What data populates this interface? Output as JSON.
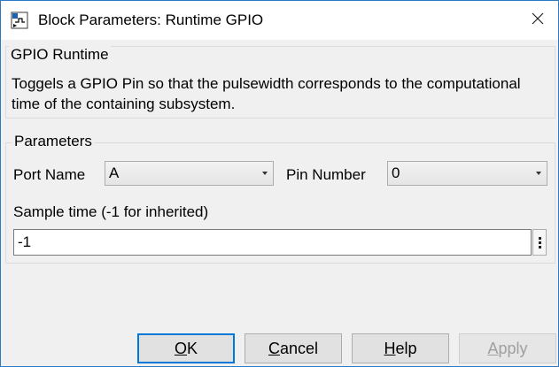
{
  "window": {
    "title": "Block Parameters: Runtime GPIO"
  },
  "description": {
    "heading": "GPIO Runtime",
    "text": "Toggels a GPIO Pin so that the pulsewidth corresponds to the computational time of the containing subsystem."
  },
  "parameters": {
    "heading": "Parameters",
    "port_name": {
      "label": "Port Name",
      "value": "A"
    },
    "pin_number": {
      "label": "Pin Number",
      "value": "0"
    },
    "sample_time": {
      "label": "Sample time (-1 for inherited)",
      "value": "-1"
    }
  },
  "buttons": {
    "ok": {
      "mnemonic": "O",
      "rest": "K"
    },
    "cancel": {
      "mnemonic": "C",
      "rest": "ancel"
    },
    "help": {
      "mnemonic": "H",
      "rest": "elp"
    },
    "apply": {
      "mnemonic": "A",
      "rest": "pply",
      "enabled": false
    }
  },
  "icons": {
    "app": "simulink-block-icon",
    "close": "close-icon",
    "more": "vertical-dots-icon"
  },
  "colors": {
    "accent": "#0078d7",
    "window_border": "#2b78c4",
    "disabled_text": "#a0a0a0"
  }
}
